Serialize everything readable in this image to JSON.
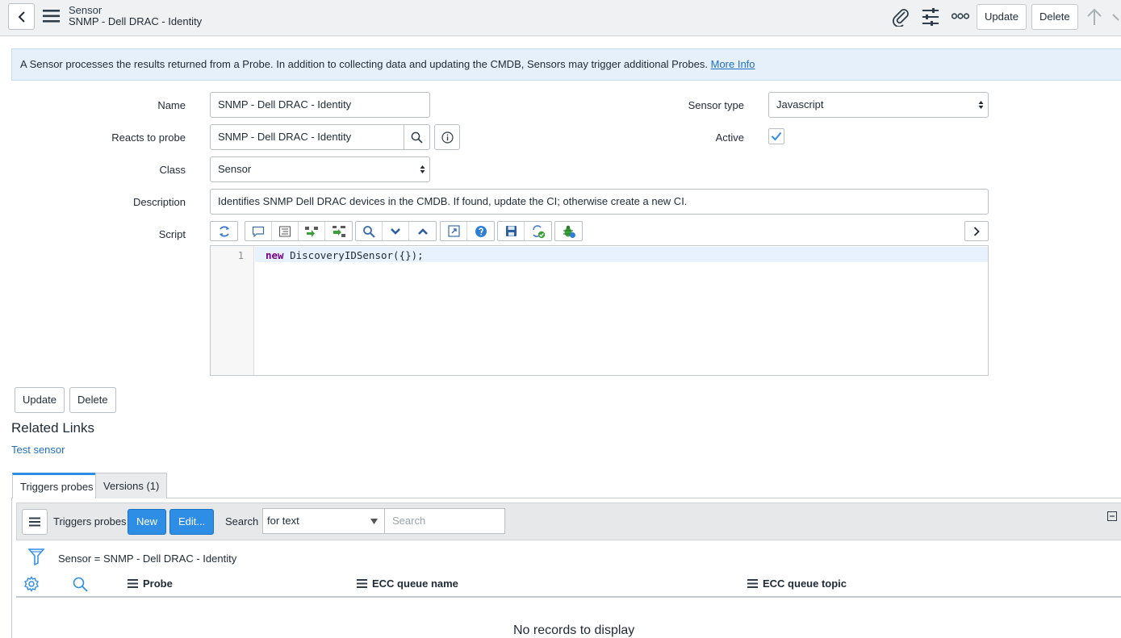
{
  "header": {
    "record_type": "Sensor",
    "record_name": "SNMP - Dell DRAC - Identity",
    "update_label": "Update",
    "delete_label": "Delete"
  },
  "banner": {
    "text": "A Sensor processes the results returned from a Probe. In addition to collecting data and updating the CMDB, Sensors may trigger additional Probes.",
    "link": "More Info"
  },
  "form": {
    "name_label": "Name",
    "name_value": "SNMP - Dell DRAC - Identity",
    "reacts_label": "Reacts to probe",
    "reacts_value": "SNMP - Dell DRAC - Identity",
    "class_label": "Class",
    "class_value": "Sensor",
    "sensor_type_label": "Sensor type",
    "sensor_type_value": "Javascript",
    "active_label": "Active",
    "active_checked": true,
    "description_label": "Description",
    "description_value": "Identifies SNMP Dell DRAC devices in the CMDB. If found, update the CI; otherwise create a new CI.",
    "script_label": "Script"
  },
  "script": {
    "line_number": "1",
    "keyword": "new",
    "code_rest": " DiscoveryIDSensor({});"
  },
  "form_buttons": {
    "update_label": "Update",
    "delete_label": "Delete"
  },
  "related": {
    "title": "Related Links",
    "test_link": "Test sensor"
  },
  "tabs": [
    {
      "label": "Triggers probes",
      "active": true
    },
    {
      "label": "Versions (1)",
      "active": false
    }
  ],
  "list": {
    "title": "Triggers probes",
    "new_label": "New",
    "edit_label": "Edit...",
    "search_label": "Search",
    "search_field": "for text",
    "search_placeholder": "Search",
    "filter": "Sensor = SNMP - Dell DRAC - Identity",
    "columns": [
      "Probe",
      "ECC queue name",
      "ECC queue topic"
    ],
    "empty_message": "No records to display"
  },
  "colors": {
    "accent": "#2e8ee6",
    "link": "#1f6fc4",
    "header_bg": "#f0f1f2"
  }
}
